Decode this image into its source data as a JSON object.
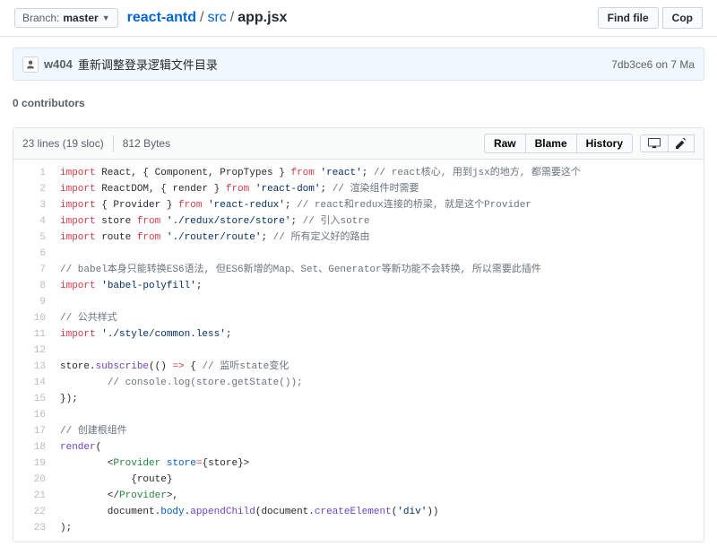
{
  "branch": {
    "label": "Branch:",
    "name": "master"
  },
  "breadcrumb": {
    "repo": "react-antd",
    "folder": "src",
    "file": "app.jsx"
  },
  "actions": {
    "find_file": "Find file",
    "copy": "Cop"
  },
  "commit": {
    "author": "w404",
    "message": "重新调整登录逻辑文件目录",
    "sha": "7db3ce6",
    "date": "on 7 Ma"
  },
  "contributors": {
    "count": "0",
    "label": "contributors"
  },
  "file_meta": {
    "lines": "23 lines (19 sloc)",
    "size": "812 Bytes"
  },
  "file_actions": {
    "raw": "Raw",
    "blame": "Blame",
    "history": "History"
  },
  "icon_names": {
    "desktop": "desktop-icon",
    "pencil": "pencil-icon"
  },
  "code": {
    "line_count": 23,
    "lines": [
      {
        "n": 1,
        "tokens": [
          [
            "k",
            "import"
          ],
          [
            "p",
            " React"
          ],
          [
            "p",
            ", { "
          ],
          [
            "p",
            "Component"
          ],
          [
            "p",
            ", "
          ],
          [
            "p",
            "PropTypes"
          ],
          [
            "p",
            " } "
          ],
          [
            "k",
            "from"
          ],
          [
            "p",
            " "
          ],
          [
            "s",
            "'react'"
          ],
          [
            "p",
            "; "
          ],
          [
            "c",
            "// react核心, 用到jsx的地方, 都需要这个"
          ]
        ]
      },
      {
        "n": 2,
        "tokens": [
          [
            "k",
            "import"
          ],
          [
            "p",
            " ReactDOM"
          ],
          [
            "p",
            ", { "
          ],
          [
            "p",
            "render"
          ],
          [
            "p",
            " } "
          ],
          [
            "k",
            "from"
          ],
          [
            "p",
            " "
          ],
          [
            "s",
            "'react-dom'"
          ],
          [
            "p",
            "; "
          ],
          [
            "c",
            "// 渲染组件时需要"
          ]
        ]
      },
      {
        "n": 3,
        "tokens": [
          [
            "k",
            "import"
          ],
          [
            "p",
            " { "
          ],
          [
            "p",
            "Provider"
          ],
          [
            "p",
            " } "
          ],
          [
            "k",
            "from"
          ],
          [
            "p",
            " "
          ],
          [
            "s",
            "'react-redux'"
          ],
          [
            "p",
            "; "
          ],
          [
            "c",
            "// react和redux连接的桥梁, 就是这个Provider"
          ]
        ]
      },
      {
        "n": 4,
        "tokens": [
          [
            "k",
            "import"
          ],
          [
            "p",
            " store "
          ],
          [
            "k",
            "from"
          ],
          [
            "p",
            " "
          ],
          [
            "s",
            "'./redux/store/store'"
          ],
          [
            "p",
            "; "
          ],
          [
            "c",
            "// 引入sotre"
          ]
        ]
      },
      {
        "n": 5,
        "tokens": [
          [
            "k",
            "import"
          ],
          [
            "p",
            " route "
          ],
          [
            "k",
            "from"
          ],
          [
            "p",
            " "
          ],
          [
            "s",
            "'./router/route'"
          ],
          [
            "p",
            "; "
          ],
          [
            "c",
            "// 所有定义好的路由"
          ]
        ]
      },
      {
        "n": 6,
        "tokens": []
      },
      {
        "n": 7,
        "tokens": [
          [
            "c",
            "// babel本身只能转换ES6语法, 但ES6新增的Map、Set、Generator等新功能不会转换, 所以需要此插件"
          ]
        ]
      },
      {
        "n": 8,
        "tokens": [
          [
            "k",
            "import"
          ],
          [
            "p",
            " "
          ],
          [
            "s",
            "'babel-polyfill'"
          ],
          [
            "p",
            ";"
          ]
        ]
      },
      {
        "n": 9,
        "tokens": []
      },
      {
        "n": 10,
        "tokens": [
          [
            "c",
            "// 公共样式"
          ]
        ]
      },
      {
        "n": 11,
        "tokens": [
          [
            "k",
            "import"
          ],
          [
            "p",
            " "
          ],
          [
            "s",
            "'./style/common.less'"
          ],
          [
            "p",
            ";"
          ]
        ]
      },
      {
        "n": 12,
        "tokens": []
      },
      {
        "n": 13,
        "tokens": [
          [
            "p",
            "store."
          ],
          [
            "f",
            "subscribe"
          ],
          [
            "p",
            "(() "
          ],
          [
            "k",
            "=>"
          ],
          [
            "p",
            " { "
          ],
          [
            "c",
            "// 监听state变化"
          ]
        ]
      },
      {
        "n": 14,
        "tokens": [
          [
            "p",
            "        "
          ],
          [
            "c",
            "// console.log(store.getState());"
          ]
        ]
      },
      {
        "n": 15,
        "tokens": [
          [
            "p",
            "});"
          ]
        ]
      },
      {
        "n": 16,
        "tokens": []
      },
      {
        "n": 17,
        "tokens": [
          [
            "c",
            "// 创建根组件"
          ]
        ]
      },
      {
        "n": 18,
        "tokens": [
          [
            "f",
            "render"
          ],
          [
            "p",
            "("
          ]
        ]
      },
      {
        "n": 19,
        "tokens": [
          [
            "p",
            "        <"
          ],
          [
            "t",
            "Provider"
          ],
          [
            "p",
            " "
          ],
          [
            "o",
            "store"
          ],
          [
            "k",
            "="
          ],
          [
            "p",
            "{store}>"
          ]
        ]
      },
      {
        "n": 20,
        "tokens": [
          [
            "p",
            "            {route}"
          ]
        ]
      },
      {
        "n": 21,
        "tokens": [
          [
            "p",
            "        </"
          ],
          [
            "t",
            "Provider"
          ],
          [
            "p",
            ">,"
          ]
        ]
      },
      {
        "n": 22,
        "tokens": [
          [
            "p",
            "        document."
          ],
          [
            "o",
            "body"
          ],
          [
            "p",
            "."
          ],
          [
            "f",
            "appendChild"
          ],
          [
            "p",
            "(document."
          ],
          [
            "f",
            "createElement"
          ],
          [
            "p",
            "("
          ],
          [
            "s",
            "'div'"
          ],
          [
            "p",
            "))"
          ]
        ]
      },
      {
        "n": 23,
        "tokens": [
          [
            "p",
            ");"
          ]
        ]
      }
    ]
  }
}
